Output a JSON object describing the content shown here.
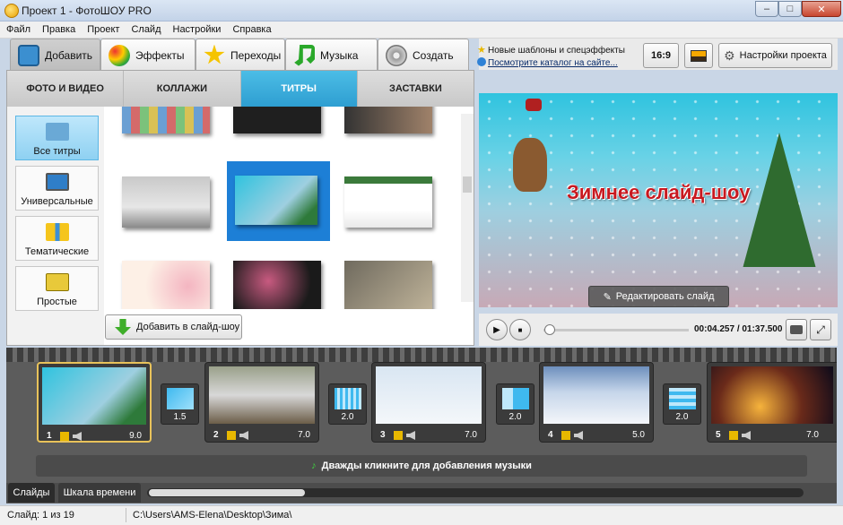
{
  "window": {
    "title": "Проект 1 - ФотоШОУ PRO",
    "minimize": "–",
    "maximize": "□",
    "close": "✕"
  },
  "menu": [
    "Файл",
    "Правка",
    "Проект",
    "Слайд",
    "Настройки",
    "Справка"
  ],
  "main_tabs": [
    {
      "label": "Добавить",
      "icon": "camera-icon",
      "active": true
    },
    {
      "label": "Эффекты",
      "icon": "palette-icon"
    },
    {
      "label": "Переходы",
      "icon": "star-icon"
    },
    {
      "label": "Музыка",
      "icon": "music-note-icon"
    },
    {
      "label": "Создать",
      "icon": "film-reel-icon"
    }
  ],
  "sub_tabs": [
    {
      "label": "ФОТО И ВИДЕО"
    },
    {
      "label": "КОЛЛАЖИ"
    },
    {
      "label": "ТИТРЫ",
      "active": true
    },
    {
      "label": "ЗАСТАВКИ"
    }
  ],
  "categories": [
    {
      "label": "Все титры",
      "icon": "abc-icon",
      "active": true
    },
    {
      "label": "Универсальные",
      "icon": "monitor-icon"
    },
    {
      "label": "Тематические",
      "icon": "gift-icon"
    },
    {
      "label": "Простые",
      "icon": "abc-icon"
    }
  ],
  "add_slide_button": "Добавить в слайд-шоу",
  "promo": {
    "line1": "Новые шаблоны и спецэффекты",
    "line2": "Посмотрите каталог на сайте..."
  },
  "right_buttons": {
    "aspect": "16:9",
    "settings": "Настройки проекта"
  },
  "preview": {
    "title": "Зимнее слайд-шоу",
    "edit_button": "Редактировать слайд"
  },
  "player": {
    "time": "00:04.257 / 01:37.500",
    "progress": 0.04
  },
  "slides": [
    {
      "num": "1",
      "duration": "9.0"
    },
    {
      "num": "2",
      "duration": "7.0"
    },
    {
      "num": "3",
      "duration": "7.0"
    },
    {
      "num": "4",
      "duration": "5.0"
    },
    {
      "num": "5",
      "duration": "7.0"
    }
  ],
  "transitions": [
    "1.5",
    "2.0",
    "2.0",
    "2.0"
  ],
  "music_hint": "Дважды кликните для добавления музыки",
  "bottom_tabs": [
    {
      "label": "Слайды",
      "active": true
    },
    {
      "label": "Шкала времени"
    }
  ],
  "status": {
    "slide": "Слайд: 1 из 19",
    "path": "C:\\Users\\AMS-Elena\\Desktop\\Зима\\"
  }
}
